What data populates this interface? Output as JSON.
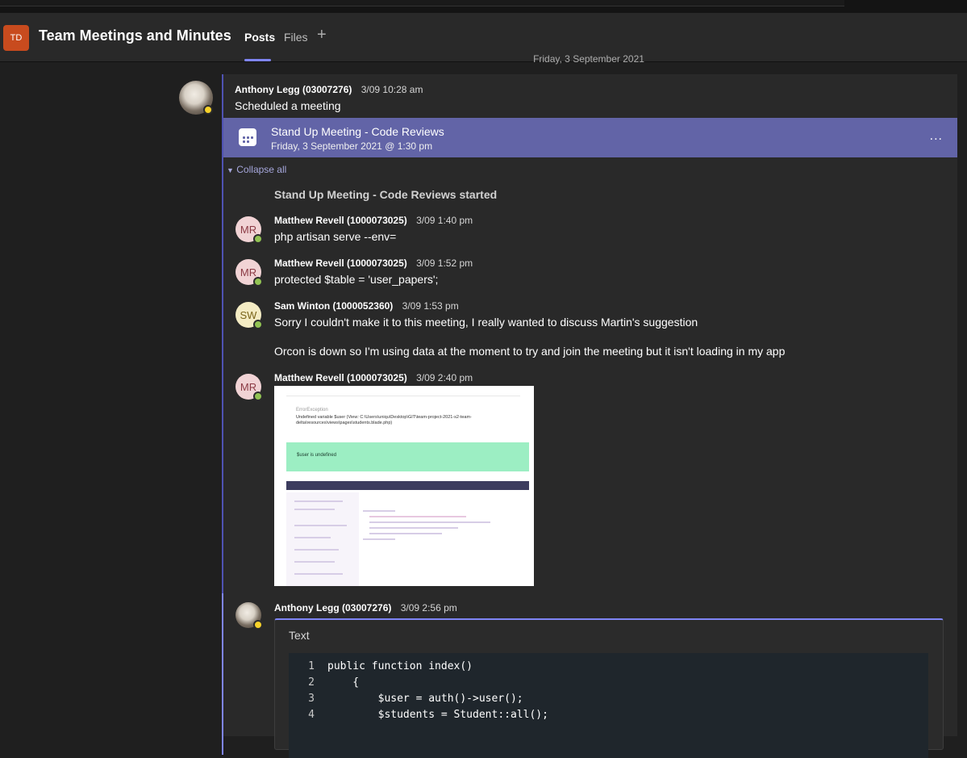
{
  "header": {
    "team_initials": "TD",
    "team_title": "Team Meetings and Minutes",
    "tabs": [
      {
        "label": "Posts",
        "active": true
      },
      {
        "label": "Files",
        "active": false
      }
    ],
    "add_tab_symbol": "+"
  },
  "date_divider": "Friday, 3 September 2021",
  "thread": {
    "root": {
      "author": "Anthony Legg (03007276)",
      "time": "3/09 10:28 am",
      "text": "Scheduled a meeting",
      "presence": "away"
    },
    "meeting_card": {
      "title": "Stand Up Meeting - Code Reviews",
      "subtitle": "Friday, 3 September 2021 @ 1:30 pm",
      "more": "..."
    },
    "collapse_label": "Collapse all",
    "system_message": "Stand Up Meeting - Code Reviews started",
    "replies": [
      {
        "initials": "MR",
        "author": "Matthew Revell (1000073025)",
        "time": "3/09 1:40 pm",
        "text": "php artisan serve --env="
      },
      {
        "initials": "MR",
        "author": "Matthew Revell (1000073025)",
        "time": "3/09 1:52 pm",
        "text": "protected $table = 'user_papers';"
      },
      {
        "initials": "SW",
        "author": "Sam Winton (1000052360)",
        "time": "3/09 1:53 pm",
        "text": "Sorry I couldn't make it to this meeting, I really wanted to discuss Martin's suggestion",
        "text2": "Orcon is down so I'm using data at the moment to try and join the meeting but it isn't loading in my app"
      },
      {
        "initials": "MR",
        "author": "Matthew Revell (1000073025)",
        "time": "3/09 2:40 pm"
      },
      {
        "author": "Anthony Legg (03007276)",
        "time": "3/09 2:56 pm"
      }
    ],
    "screenshot": {
      "error_label": "ErrorException",
      "error_message": "Undefined variable $user (View: C:\\Users\\uniqu\\Desktop\\GIT\\team-project-2021-s2-team-delta\\resources\\views\\pages\\students.blade.php)",
      "banner": "$user is undefined"
    },
    "code_card": {
      "label": "Text",
      "lines": [
        {
          "n": "1",
          "code": "public function index()"
        },
        {
          "n": "2",
          "code": "    {"
        },
        {
          "n": "3",
          "code": "        $user = auth()->user();"
        },
        {
          "n": "4",
          "code": "        $students = Student::all();"
        }
      ]
    }
  }
}
